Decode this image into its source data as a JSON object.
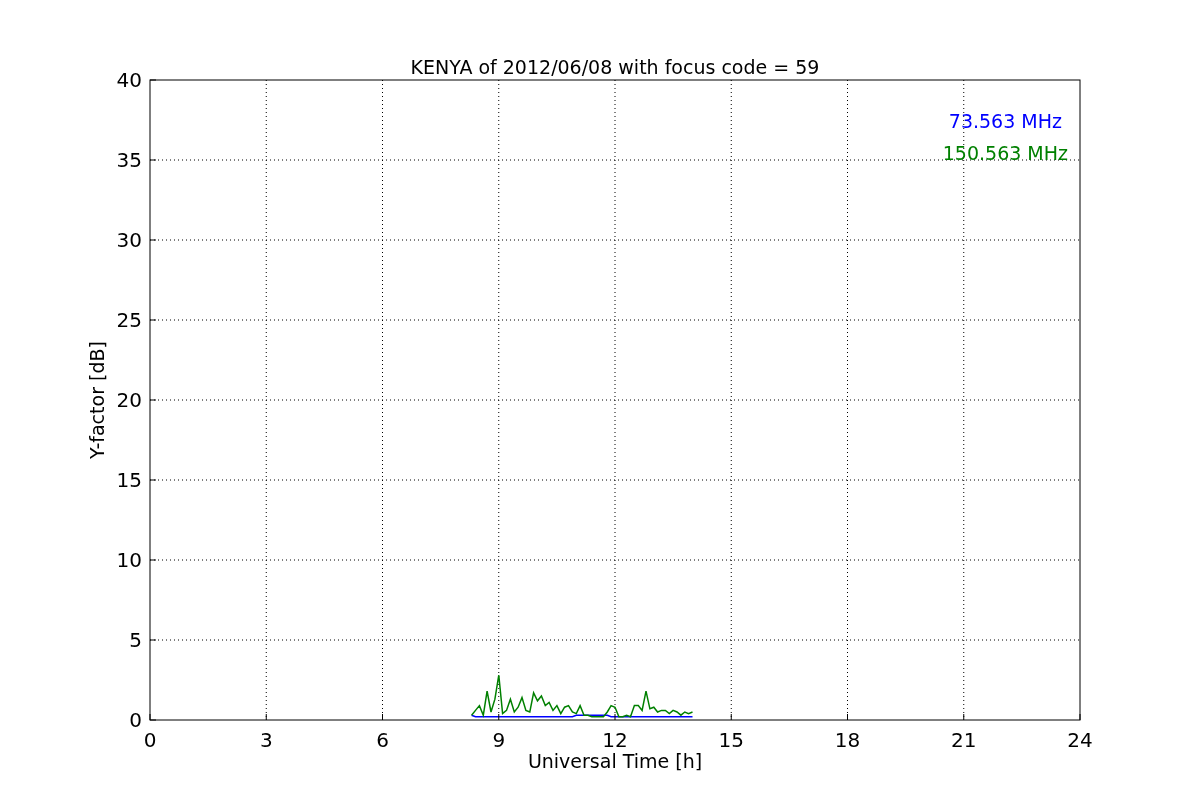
{
  "chart_data": {
    "type": "line",
    "title": "KENYA of 2012/06/08 with focus code = 59",
    "xlabel": "Universal Time [h]",
    "ylabel": "Y-factor [dB]",
    "grid": true,
    "xlim": [
      0,
      24
    ],
    "ylim": [
      0,
      40
    ],
    "xticks": [
      0,
      3,
      6,
      9,
      12,
      15,
      18,
      21,
      24
    ],
    "yticks": [
      0,
      5,
      10,
      15,
      20,
      25,
      30,
      35,
      40
    ],
    "x": [
      8.3,
      8.4,
      8.5,
      8.6,
      8.7,
      8.8,
      8.9,
      9.0,
      9.1,
      9.2,
      9.3,
      9.4,
      9.5,
      9.6,
      9.7,
      9.8,
      9.9,
      10.0,
      10.1,
      10.2,
      10.3,
      10.4,
      10.5,
      10.6,
      10.7,
      10.8,
      10.9,
      11.0,
      11.1,
      11.2,
      11.3,
      11.4,
      11.5,
      11.6,
      11.7,
      11.8,
      11.9,
      12.0,
      12.1,
      12.2,
      12.3,
      12.4,
      12.5,
      12.6,
      12.7,
      12.8,
      12.9,
      13.0,
      13.1,
      13.2,
      13.3,
      13.4,
      13.5,
      13.6,
      13.7,
      13.8,
      13.9,
      14.0
    ],
    "series": [
      {
        "name": "73.563 MHz",
        "color": "#0000ff",
        "values": [
          0.3,
          0.2,
          0.2,
          0.2,
          0.2,
          0.2,
          0.2,
          0.2,
          0.2,
          0.2,
          0.2,
          0.2,
          0.2,
          0.2,
          0.2,
          0.2,
          0.2,
          0.2,
          0.2,
          0.2,
          0.2,
          0.2,
          0.2,
          0.2,
          0.2,
          0.2,
          0.2,
          0.3,
          0.3,
          0.3,
          0.3,
          0.3,
          0.3,
          0.3,
          0.3,
          0.3,
          0.2,
          0.2,
          0.2,
          0.2,
          0.2,
          0.2,
          0.2,
          0.2,
          0.2,
          0.2,
          0.2,
          0.2,
          0.2,
          0.2,
          0.2,
          0.2,
          0.2,
          0.2,
          0.2,
          0.2,
          0.2,
          0.2
        ]
      },
      {
        "name": "150.563 MHz",
        "color": "#008000",
        "values": [
          0.3,
          0.6,
          0.9,
          0.3,
          1.8,
          0.5,
          1.3,
          2.8,
          0.4,
          0.6,
          1.3,
          0.5,
          0.8,
          1.4,
          0.6,
          0.5,
          1.7,
          1.2,
          1.5,
          0.9,
          1.1,
          0.6,
          0.9,
          0.4,
          0.8,
          0.9,
          0.5,
          0.4,
          0.9,
          0.3,
          0.3,
          0.2,
          0.2,
          0.2,
          0.2,
          0.5,
          0.9,
          0.8,
          0.2,
          0.2,
          0.3,
          0.2,
          0.9,
          0.9,
          0.6,
          1.8,
          0.7,
          0.8,
          0.5,
          0.6,
          0.6,
          0.4,
          0.6,
          0.5,
          0.3,
          0.5,
          0.4,
          0.5
        ]
      }
    ]
  }
}
